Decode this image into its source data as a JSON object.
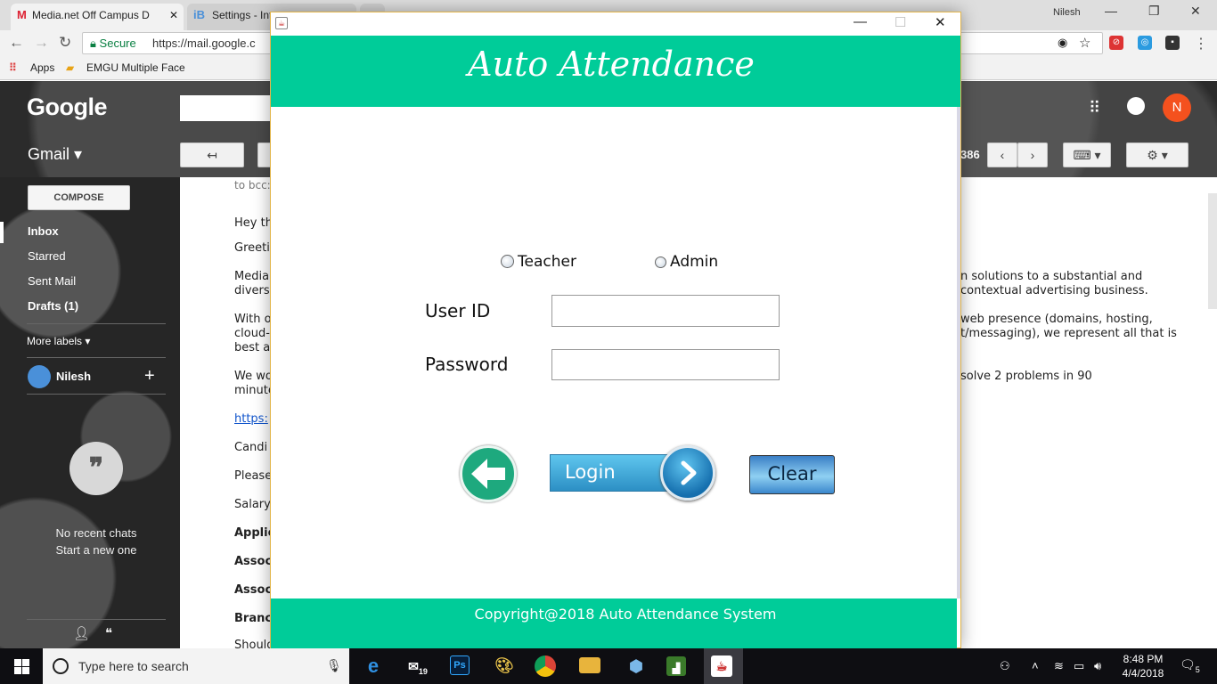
{
  "browser": {
    "tabs": [
      {
        "label": "Media.net Off Campus D",
        "favicon": "M"
      },
      {
        "label": "Settings - Int",
        "favicon": "iB"
      }
    ],
    "profile_name": "Nilesh",
    "secure_label": "Secure",
    "url": "https://mail.google.c",
    "bookmarks": {
      "apps": "Apps",
      "emgu": "EMGU Multiple Face"
    }
  },
  "gmail": {
    "logo": "Google",
    "label": "Gmail ▾",
    "count_fragment": "386",
    "avatar_letter": "N",
    "compose": "COMPOSE",
    "nav": {
      "inbox": "Inbox",
      "starred": "Starred",
      "sent": "Sent Mail",
      "drafts": "Drafts (1)",
      "more": "More labels ▾"
    },
    "user_name": "Nilesh",
    "no_chats": "No recent chats",
    "start_new": "Start a new one",
    "email": {
      "to_bcc": "to bcc:",
      "left_lines": [
        "Hey th",
        "Greeti",
        "Media.",
        "divers",
        "With o",
        "cloud-",
        "best a",
        "We wo",
        "minute",
        "https:",
        "Candi",
        "Please",
        "Salary",
        "Applic",
        "Assoc",
        "Assoc",
        "Branc",
        "Should"
      ],
      "right_lines": [
        "n solutions to a substantial and",
        "contextual advertising business.",
        "web presence (domains, hosting,",
        "t/messaging), we represent all that is",
        "solve 2 problems in 90"
      ]
    }
  },
  "app": {
    "title": "Auto Attendance",
    "radio_teacher": "Teacher",
    "radio_admin": "Admin",
    "user_id_label": "User ID",
    "password_label": "Password",
    "login_label": "Login",
    "clear_label": "Clear",
    "footer": "Copyright@2018 Auto Attendance System",
    "colors": {
      "header": "#00cc99",
      "footer": "#00cc99"
    }
  },
  "taskbar": {
    "search_placeholder": "Type here to search",
    "mail_badge": "19",
    "ps_label": "Ps",
    "time": "8:48 PM",
    "date": "4/4/2018",
    "notif_count": "5"
  }
}
